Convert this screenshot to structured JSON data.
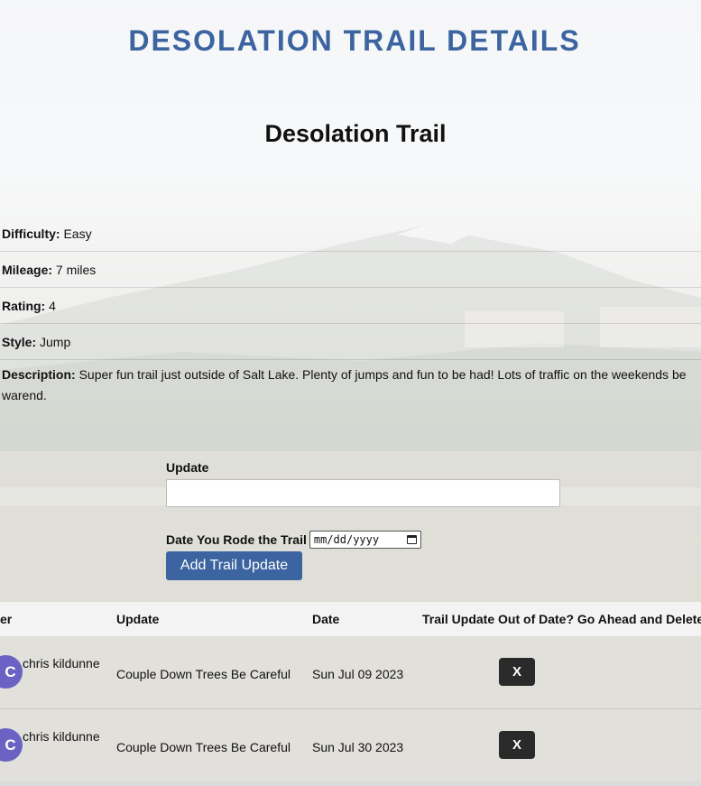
{
  "header": {
    "site_title": "DESOLATION TRAIL DETAILS"
  },
  "trail": {
    "name": "Desolation Trail",
    "details": [
      {
        "label": "Difficulty:",
        "value": "Easy"
      },
      {
        "label": "Mileage:",
        "value": "7 miles"
      },
      {
        "label": "Rating:",
        "value": "4"
      },
      {
        "label": "Style:",
        "value": "Jump"
      },
      {
        "label": "Description:",
        "value": "Super fun trail just outside of Salt Lake. Plenty of jumps and fun to be had! Lots of traffic on the weekends be warend."
      }
    ]
  },
  "form": {
    "update_label": "Update",
    "update_value": "",
    "date_label": "Date You Rode the Trail",
    "date_placeholder": "mm/dd/yyyy",
    "submit_label": "Add Trail Update"
  },
  "table": {
    "headers": [
      "er",
      "Update",
      "Date",
      "Trail Update Out of Date? Go Ahead and Delete"
    ],
    "rows": [
      {
        "avatar_initial": "C",
        "user": "chris kildunne",
        "update": "Couple Down Trees Be Careful",
        "date": "Sun Jul 09 2023",
        "delete_label": "X"
      },
      {
        "avatar_initial": "C",
        "user": "chris kildunne",
        "update": "Couple Down Trees Be Careful",
        "date": "Sun Jul 30 2023",
        "delete_label": "X"
      }
    ]
  },
  "colors": {
    "title": "#3b64a0",
    "button": "#3b64a0",
    "avatar": "#6a63c4",
    "delete_button": "#2a2a2a"
  },
  "icons": {
    "date_picker": "calendar-icon"
  }
}
